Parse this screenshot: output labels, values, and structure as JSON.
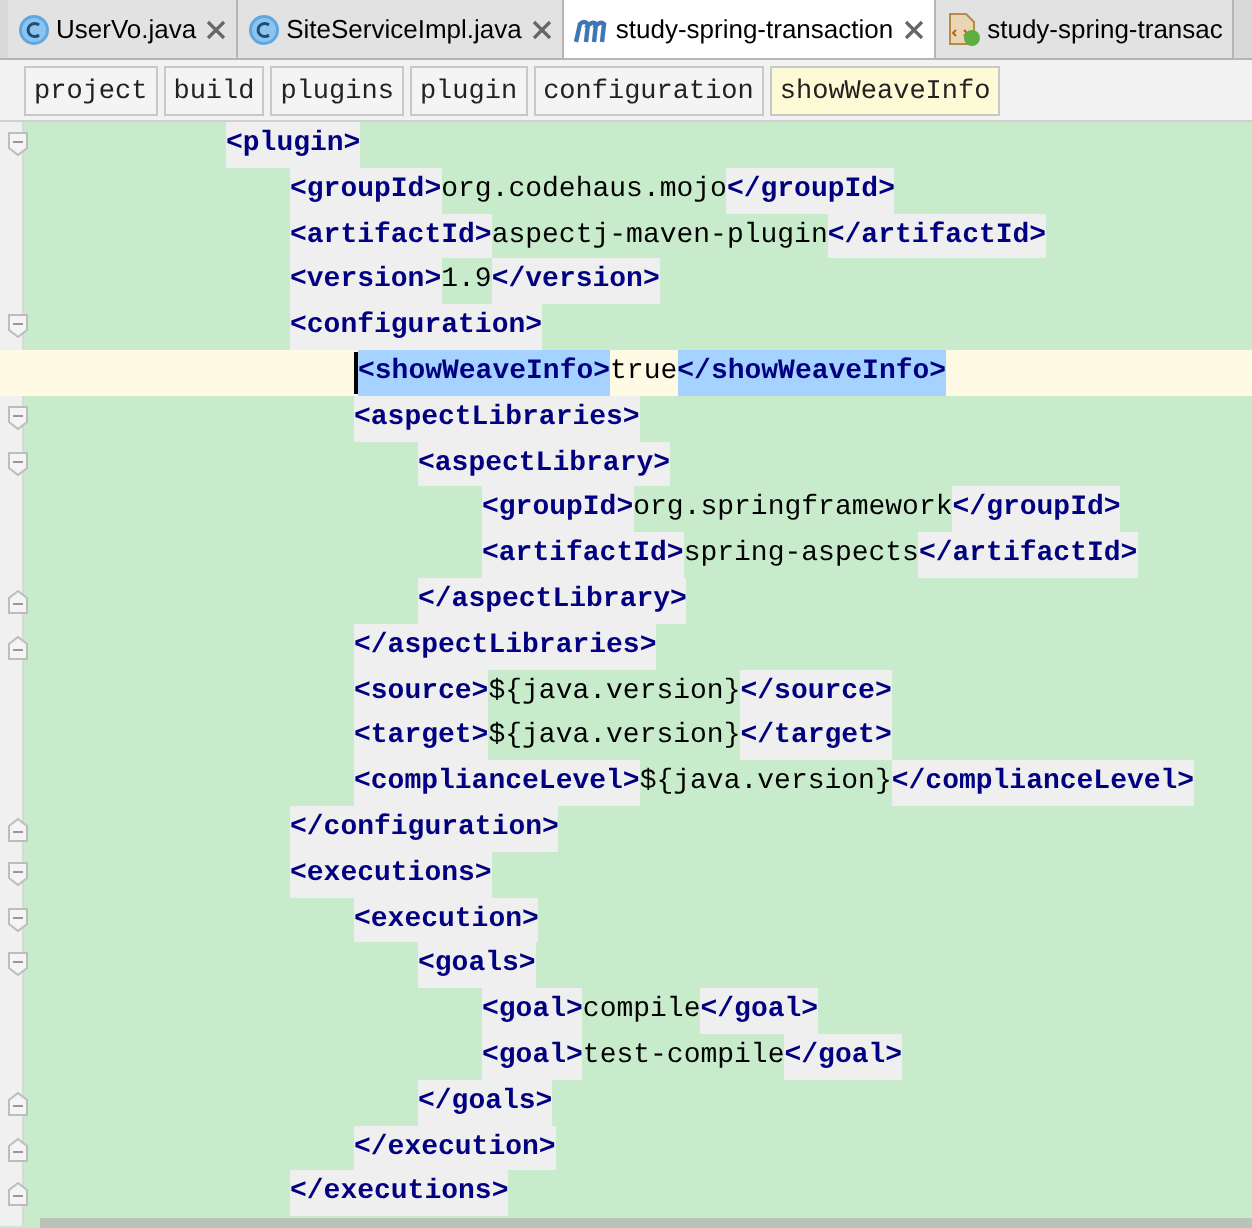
{
  "tabs": [
    {
      "label": "UserVo.java",
      "kind": "class",
      "selected": false,
      "closable": true
    },
    {
      "label": "SiteServiceImpl.java",
      "kind": "class",
      "selected": false,
      "closable": true
    },
    {
      "label": "study-spring-transaction",
      "kind": "maven",
      "selected": true,
      "closable": true
    },
    {
      "label": "study-spring-transac",
      "kind": "xml",
      "selected": false,
      "closable": false
    }
  ],
  "breadcrumbs": [
    {
      "label": "project",
      "selected": false
    },
    {
      "label": "build",
      "selected": false
    },
    {
      "label": "plugins",
      "selected": false
    },
    {
      "label": "plugin",
      "selected": false
    },
    {
      "label": "configuration",
      "selected": false
    },
    {
      "label": "showWeaveInfo",
      "selected": true
    }
  ],
  "code": [
    {
      "open": "<plugin>",
      "current": false,
      "children": [
        {
          "open": "<groupId>",
          "value": "org.codehaus.mojo",
          "close": "</groupId>",
          "current": false
        },
        {
          "open": "<artifactId>",
          "value": "aspectj-maven-plugin",
          "close": "</artifactId>",
          "current": false
        },
        {
          "open": "<version>",
          "value": "1.9",
          "close": "</version>",
          "current": false
        },
        {
          "open": "<configuration>",
          "current": false,
          "close": "</configuration>",
          "children": [
            {
              "open": "<showWeaveInfo>",
              "value": "true",
              "close": "</showWeaveInfo>",
              "current": true
            },
            {
              "open": "<aspectLibraries>",
              "current": false,
              "close": "</aspectLibraries>",
              "children": [
                {
                  "open": "<aspectLibrary>",
                  "current": false,
                  "close": "</aspectLibrary>",
                  "children": [
                    {
                      "open": "<groupId>",
                      "value": "org.springframework",
                      "close": "</groupId>",
                      "current": false
                    },
                    {
                      "open": "<artifactId>",
                      "value": "spring-aspects",
                      "close": "</artifactId>",
                      "current": false
                    }
                  ]
                }
              ]
            },
            {
              "open": "<source>",
              "value": "${java.version}",
              "close": "</source>",
              "current": false
            },
            {
              "open": "<target>",
              "value": "${java.version}",
              "close": "</target>",
              "current": false
            },
            {
              "open": "<complianceLevel>",
              "value": "${java.version}",
              "close": "</complianceLevel>",
              "current": false
            }
          ]
        },
        {
          "open": "<executions>",
          "current": false,
          "close": "</executions>",
          "children": [
            {
              "open": "<execution>",
              "current": false,
              "close": "</execution>",
              "children": [
                {
                  "open": "<goals>",
                  "current": false,
                  "close": "</goals>",
                  "children": [
                    {
                      "open": "<goal>",
                      "value": "compile",
                      "close": "</goal>",
                      "current": false
                    },
                    {
                      "open": "<goal>",
                      "value": "test-compile",
                      "close": "</goal>",
                      "current": false
                    }
                  ]
                }
              ]
            }
          ]
        }
      ]
    }
  ]
}
